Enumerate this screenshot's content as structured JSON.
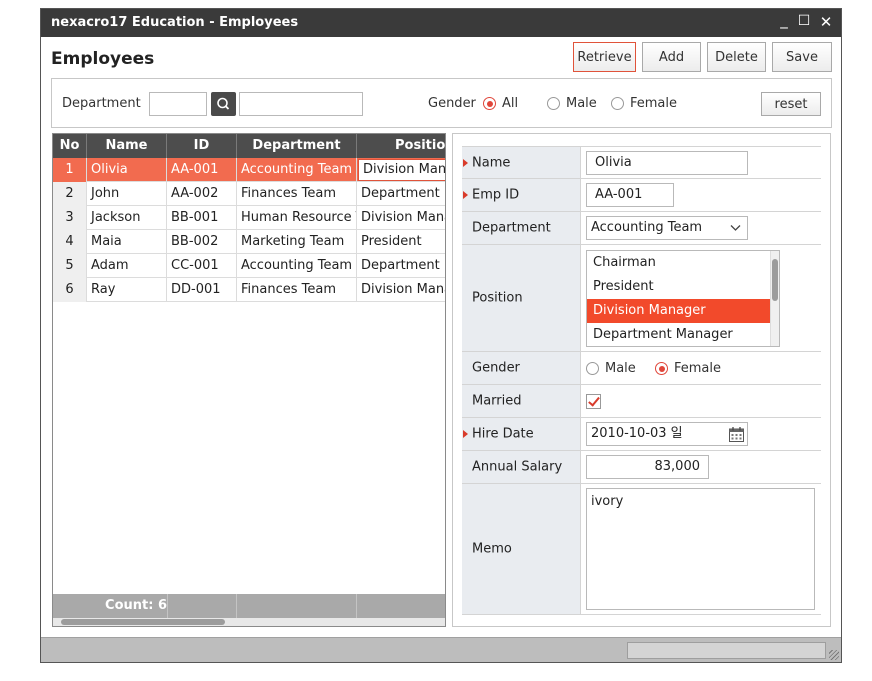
{
  "window": {
    "title": "nexacro17 Education - Employees",
    "min": "_",
    "max": "☐",
    "close": "✕"
  },
  "page": {
    "title": "Employees"
  },
  "toolbar": {
    "retrieve": "Retrieve",
    "add": "Add",
    "delete": "Delete",
    "save": "Save"
  },
  "search": {
    "department_label": "Department",
    "department_code": "",
    "department_name": "",
    "gender_label": "Gender",
    "gender_all": "All",
    "gender_male": "Male",
    "gender_female": "Female",
    "gender_selected": "All",
    "reset": "reset"
  },
  "grid": {
    "columns": [
      "No",
      "Name",
      "ID",
      "Department",
      "Position"
    ],
    "rows": [
      [
        "1",
        "Olivia",
        "AA-001",
        "Accounting Team",
        "Division Manager"
      ],
      [
        "2",
        "John",
        "AA-002",
        "Finances Team",
        "Department Manager"
      ],
      [
        "3",
        "Jackson",
        "BB-001",
        "Human Resource Team",
        "Division Manager"
      ],
      [
        "4",
        "Maia",
        "BB-002",
        "Marketing Team",
        "President"
      ],
      [
        "5",
        "Adam",
        "CC-001",
        "Accounting Team",
        "Department Manager"
      ],
      [
        "6",
        "Ray",
        "DD-001",
        "Finances Team",
        "Division Manager"
      ]
    ],
    "selected_row": 0,
    "count_label": "Count: 6"
  },
  "form": {
    "name_label": "Name",
    "name": "Olivia",
    "empid_label": "Emp ID",
    "empid": "AA-001",
    "dept_label": "Department",
    "dept": "Accounting Team",
    "position_label": "Position",
    "positions": [
      "Chairman",
      "President",
      "Division Manager",
      "Department Manager"
    ],
    "position_selected": "Division Manager",
    "gender_label": "Gender",
    "gender_male": "Male",
    "gender_female": "Female",
    "gender_selected": "Female",
    "married_label": "Married",
    "married": true,
    "hire_label": "Hire Date",
    "hire": "2010-10-03 일",
    "salary_label": "Annual Salary",
    "salary": "83,000",
    "memo_label": "Memo",
    "memo": "ivory"
  },
  "colors": {
    "accent": "#f26b4f",
    "required": "#d93b2b",
    "titlebar": "#3a3a3a",
    "grid_header": "#4d4d4d"
  }
}
